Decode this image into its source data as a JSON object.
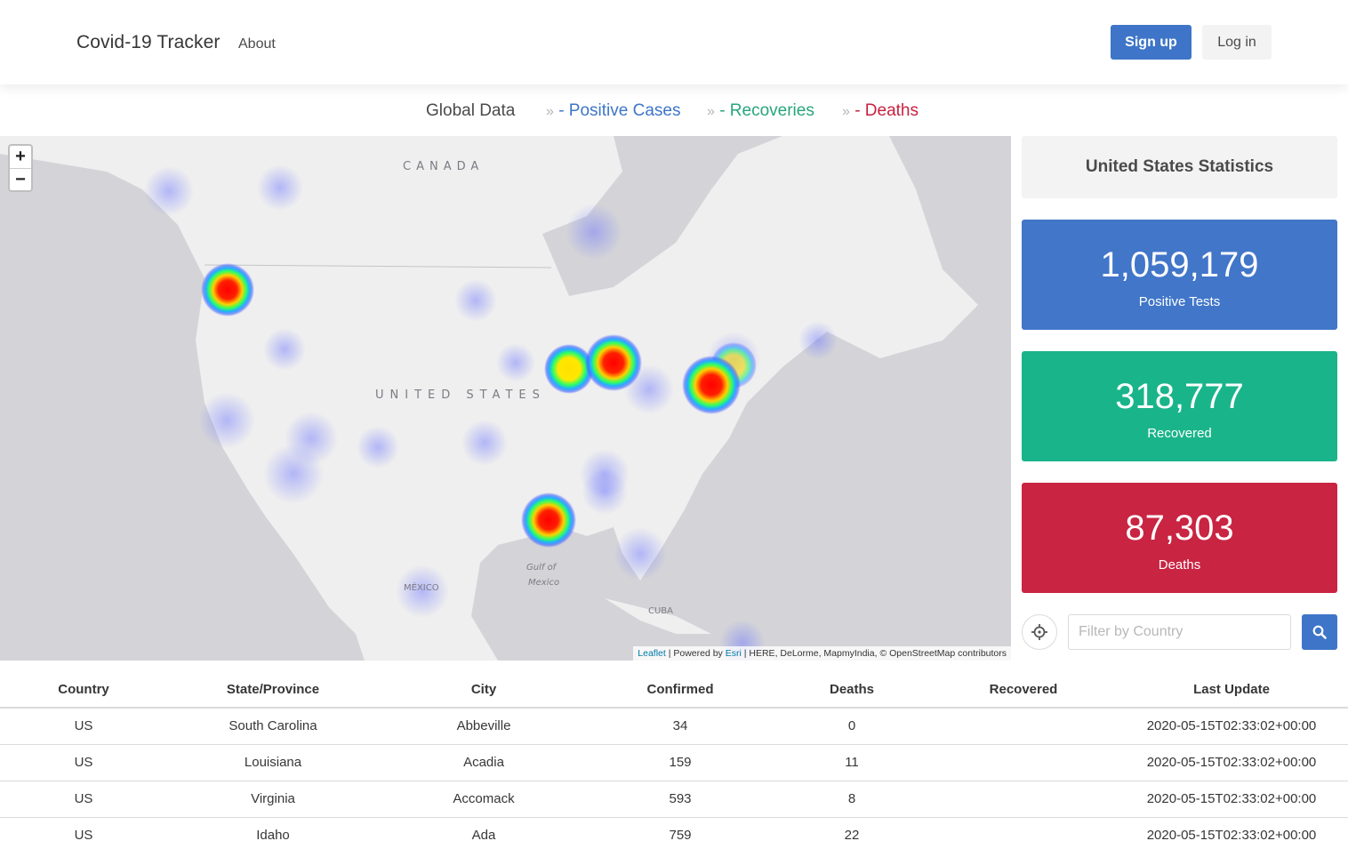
{
  "navbar": {
    "brand": "Covid-19 Tracker",
    "about": "About",
    "signup": "Sign up",
    "login": "Log in"
  },
  "crumbs": {
    "global": "Global Data",
    "sep": "»",
    "positive": "- Positive Cases",
    "recoveries": "- Recoveries",
    "deaths": "- Deaths"
  },
  "map": {
    "zoom_in": "+",
    "zoom_out": "−",
    "labels": {
      "canada": "CANADA",
      "united_states": "UNITED STATES",
      "mexico": "MÉXICO",
      "gulf": "Gulf of",
      "gulf2": "Mexico",
      "cuba": "CUBA"
    },
    "attribution": {
      "leaflet": "Leaflet",
      "powered": " | Powered by ",
      "esri": "Esri",
      "rest": " | HERE, DeLorme, MapmyIndia, © OpenStreetMap contributors"
    }
  },
  "stats": {
    "title": "United States Statistics",
    "positive_value": "1,059,179",
    "positive_label": "Positive Tests",
    "recovered_value": "318,777",
    "recovered_label": "Recovered",
    "deaths_value": "87,303",
    "deaths_label": "Deaths"
  },
  "filter": {
    "placeholder": "Filter by Country"
  },
  "icons": {
    "locate": "crosshair-icon",
    "search": "search-icon"
  },
  "colors": {
    "primary": "#3e75c8",
    "success": "#1ab48a",
    "danger": "#c92442"
  },
  "table": {
    "headers": [
      "Country",
      "State/Province",
      "City",
      "Confirmed",
      "Deaths",
      "Recovered",
      "Last Update"
    ],
    "rows": [
      [
        "US",
        "South Carolina",
        "Abbeville",
        "34",
        "0",
        "",
        "2020-05-15T02:33:02+00:00"
      ],
      [
        "US",
        "Louisiana",
        "Acadia",
        "159",
        "11",
        "",
        "2020-05-15T02:33:02+00:00"
      ],
      [
        "US",
        "Virginia",
        "Accomack",
        "593",
        "8",
        "",
        "2020-05-15T02:33:02+00:00"
      ],
      [
        "US",
        "Idaho",
        "Ada",
        "759",
        "22",
        "",
        "2020-05-15T02:33:02+00:00"
      ]
    ]
  }
}
